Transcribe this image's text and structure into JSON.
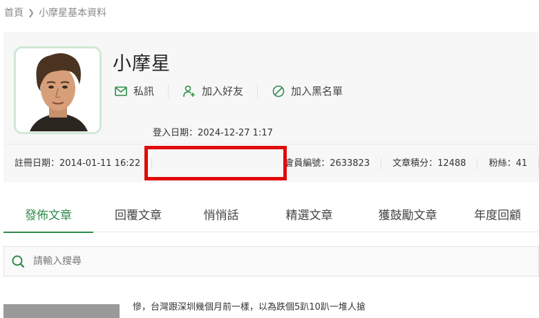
{
  "breadcrumb": {
    "home": "首頁",
    "current": "小摩星基本資料"
  },
  "profile": {
    "name": "小摩星",
    "actions": {
      "message": "私訊",
      "add_friend": "加入好友",
      "blacklist": "加入黑名單"
    },
    "stats": {
      "register": "註冊日期：2014-01-11 16:22",
      "login": "登入日期：2024-12-27 1:17",
      "member_no": "會員編號：2633823",
      "points": "文章積分：12488",
      "fans": "粉絲：41"
    }
  },
  "tabs": [
    {
      "label": "發佈文章",
      "active": true
    },
    {
      "label": "回覆文章"
    },
    {
      "label": "悄悄話"
    },
    {
      "label": "精選文章"
    },
    {
      "label": "獲鼓勵文章"
    },
    {
      "label": "年度回顧"
    }
  ],
  "search": {
    "placeholder": "請輸入搜尋"
  },
  "posts": [
    {
      "snippet": "慘，台灣跟深圳幾個月前一樣，以為跌個5趴10趴一堆人搶"
    }
  ],
  "colors": {
    "accent_green": "#2e8b4a",
    "highlight_red": "#e00a0a",
    "avatar_border": "#cfe8d4"
  },
  "icons": {
    "message": "mail-icon",
    "add_friend": "user-plus-icon",
    "blacklist": "block-icon",
    "search": "search-icon",
    "breadcrumb_sep": "chevron-right-icon"
  }
}
